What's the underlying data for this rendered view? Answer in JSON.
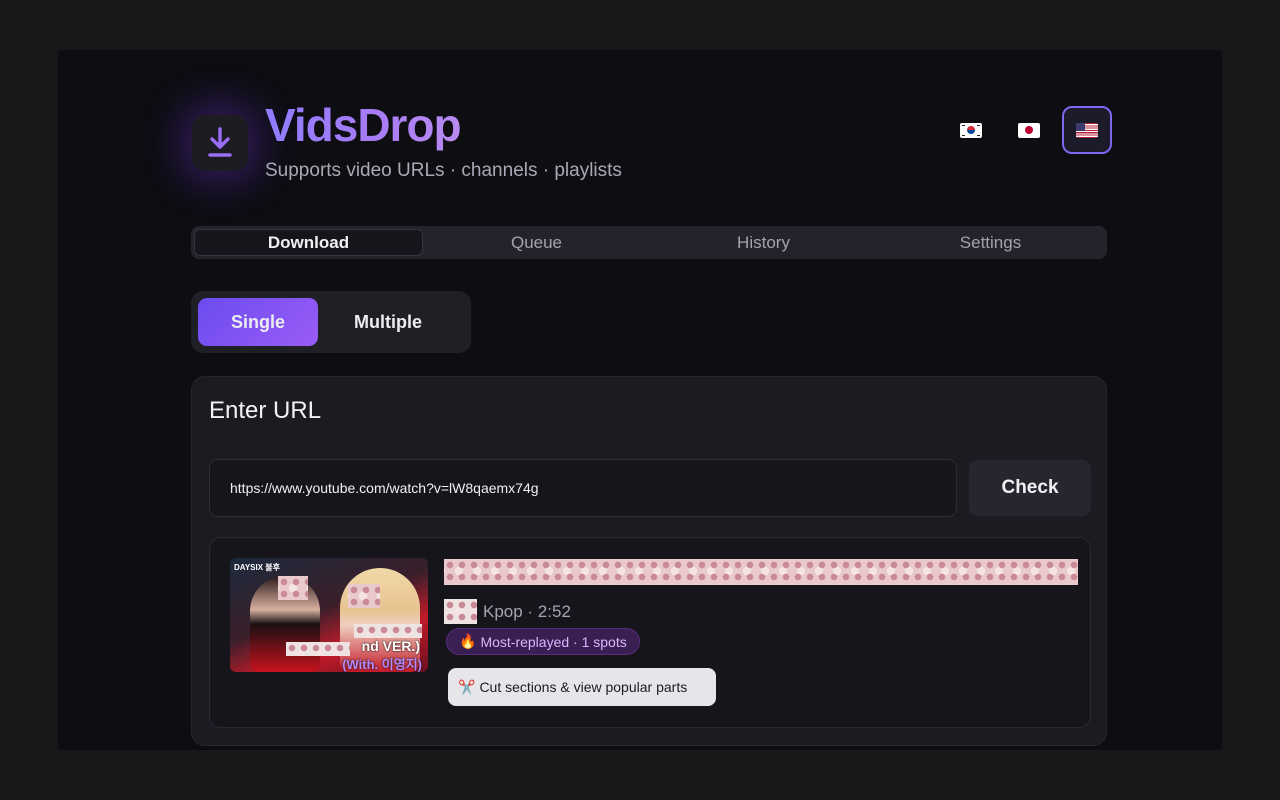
{
  "app": {
    "brand": "VidsDrop",
    "subtitle": "Supports video URLs · channels · playlists",
    "logo_icon": "download-icon",
    "accent_color": "#7c3aed"
  },
  "languages": [
    {
      "code": "ko",
      "flag": "🇰🇷",
      "active": false
    },
    {
      "code": "ja",
      "flag": "🇯🇵",
      "active": false
    },
    {
      "code": "en",
      "flag": "🇺🇸",
      "active": true
    }
  ],
  "tabs": [
    {
      "label": "Download",
      "active": true
    },
    {
      "label": "Queue",
      "active": false
    },
    {
      "label": "History",
      "active": false
    },
    {
      "label": "Settings",
      "active": false
    }
  ],
  "mode": {
    "single_label": "Single",
    "multiple_label": "Multiple",
    "selected": "Single"
  },
  "url_card": {
    "title": "Enter URL",
    "url_value": "https://www.youtube.com/watch?v=lW8qaemx74g",
    "check_label": "Check"
  },
  "result": {
    "meta": "Kpop · 2:52",
    "thumbnail_top_text": "DAYSIX 불후",
    "thumbnail_caption_1": "nd VER.)",
    "thumbnail_caption_2": "(With. 이영지)",
    "badge_icon": "🔥",
    "badge_text": "Most-replayed · 1 spots",
    "cut_icon": "✂️",
    "cut_label": "Cut sections & view popular parts"
  }
}
